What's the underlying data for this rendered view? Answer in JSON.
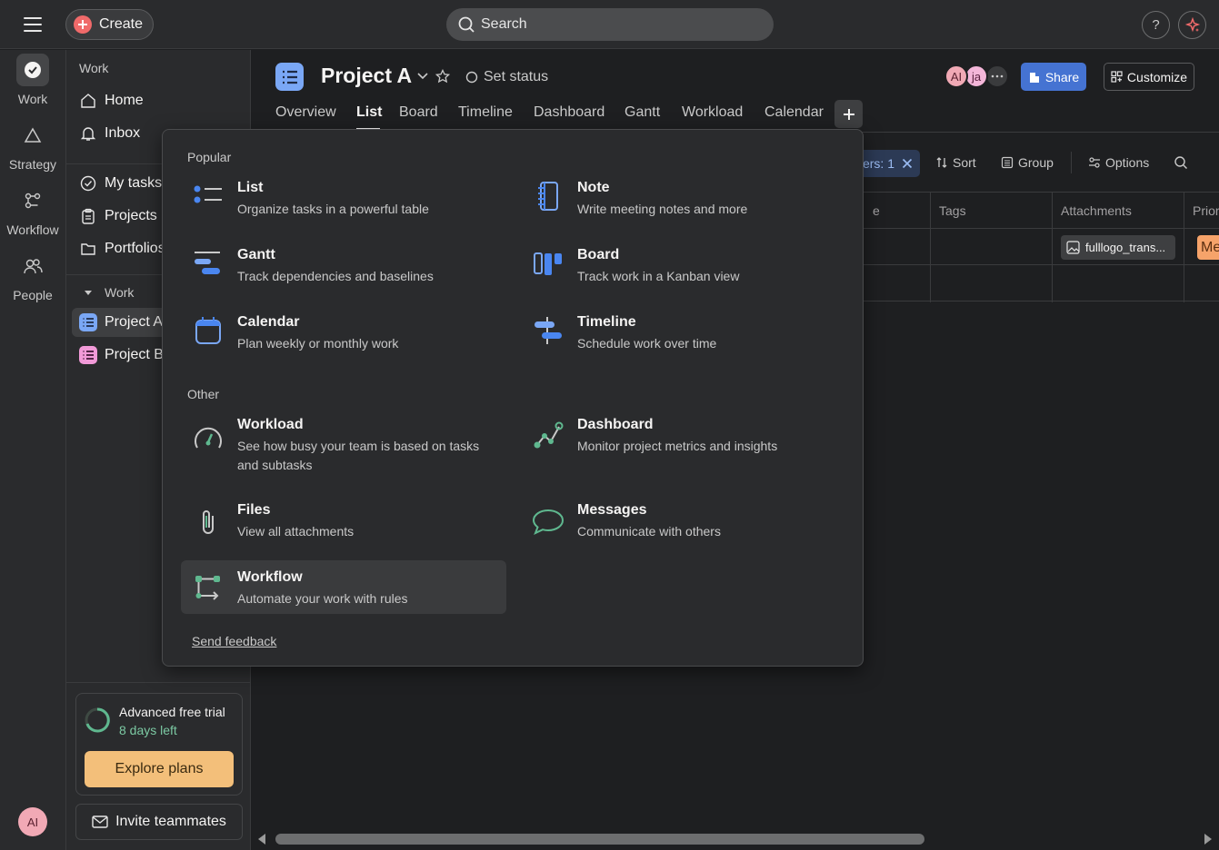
{
  "topbar": {
    "create_label": "Create",
    "search_placeholder": "Search",
    "help_label": "?"
  },
  "rail": {
    "items": [
      {
        "label": "Work",
        "icon": "check-circle-icon"
      },
      {
        "label": "Strategy",
        "icon": "triangle-icon"
      },
      {
        "label": "Workflow",
        "icon": "workflow-icon"
      },
      {
        "label": "People",
        "icon": "people-icon"
      }
    ],
    "avatar_initials": "AI"
  },
  "sidebar": {
    "work_header": "Work",
    "home": "Home",
    "inbox": "Inbox",
    "my_tasks": "My tasks",
    "projects": "Projects",
    "portfolios": "Portfolios",
    "work_section": "Work",
    "project_a": "Project A",
    "project_b": "Project B",
    "trial_title": "Advanced free trial",
    "trial_days": "8 days left",
    "explore_plans": "Explore plans",
    "invite": "Invite teammates",
    "colors": {
      "project_a": "#7aa7f5",
      "project_b": "#f29ad8"
    }
  },
  "project": {
    "title": "Project A",
    "set_status": "Set status",
    "avatars": [
      "AI",
      "ja"
    ],
    "share": "Share",
    "customize": "Customize",
    "tabs": [
      "Overview",
      "List",
      "Board",
      "Timeline",
      "Dashboard",
      "Gantt",
      "Workload",
      "Calendar"
    ],
    "active_tab": "List"
  },
  "toolbar": {
    "filter_chip": "ers: 1",
    "sort": "Sort",
    "group": "Group",
    "options": "Options"
  },
  "table": {
    "headers": [
      "e",
      "Tags",
      "Attachments",
      "Prior"
    ],
    "attachment": "fulllogo_trans...",
    "priority": "Me"
  },
  "add_menu": {
    "popular_label": "Popular",
    "other_label": "Other",
    "popular": [
      {
        "title": "List",
        "desc": "Organize tasks in a powerful table",
        "icon": "list-icon"
      },
      {
        "title": "Note",
        "desc": "Write meeting notes and more",
        "icon": "note-icon"
      },
      {
        "title": "Gantt",
        "desc": "Track dependencies and baselines",
        "icon": "gantt-icon"
      },
      {
        "title": "Board",
        "desc": "Track work in a Kanban view",
        "icon": "board-icon"
      },
      {
        "title": "Calendar",
        "desc": "Plan weekly or monthly work",
        "icon": "calendar-icon"
      },
      {
        "title": "Timeline",
        "desc": "Schedule work over time",
        "icon": "timeline-icon"
      }
    ],
    "other": [
      {
        "title": "Workload",
        "desc": "See how busy your team is based on tasks and subtasks",
        "icon": "gauge-icon"
      },
      {
        "title": "Dashboard",
        "desc": "Monitor project metrics and insights",
        "icon": "dashboard-icon"
      },
      {
        "title": "Files",
        "desc": "View all attachments",
        "icon": "paperclip-icon"
      },
      {
        "title": "Messages",
        "desc": "Communicate with others",
        "icon": "message-icon"
      },
      {
        "title": "Workflow",
        "desc": "Automate your work with rules",
        "icon": "workflow-icon"
      }
    ],
    "send_feedback": "Send feedback",
    "colors": {
      "blue": "#4a86f0",
      "green": "#5fb88f"
    }
  }
}
